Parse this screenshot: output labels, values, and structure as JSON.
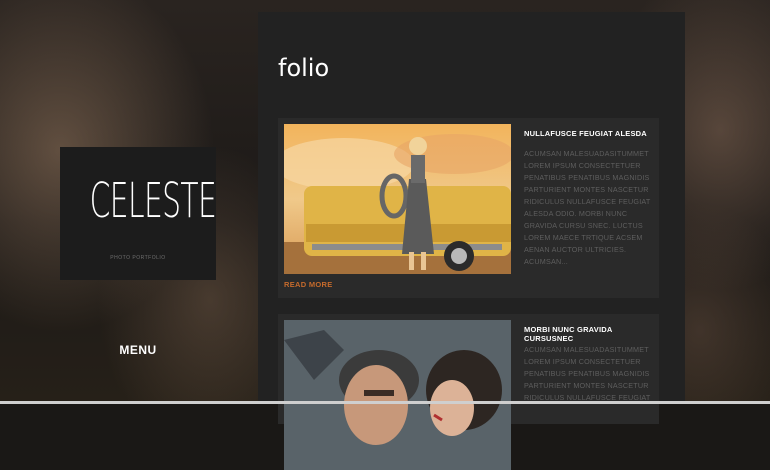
{
  "brand": {
    "logo_text": "CELESTE",
    "tagline": "PHOTO PORTFOLIO"
  },
  "nav": {
    "menu_label": "MENU"
  },
  "page": {
    "title": "folio"
  },
  "posts": [
    {
      "title": "NULLAFUSCE FEUGIAT ALESDA",
      "excerpt": "ACUMSAN MALESUADASITUMMET LOREM IPSUM CONSECTETUER PENATIBUS PENATIBUS MAGNIDIS PARTURIENT MONTES NASCETUR RIDICULUS NULLAFUSCE FEUGIAT ALESDA ODIO. MORBI NUNC GRAVIDA CURSU SNEC. LUCTUS LOREM MAECE TRTIQUE ACSEM AENAN AUCTOR ULTRICIES. ACUMSAN...",
      "read_more": "READ MORE"
    },
    {
      "title": "MORBI NUNC GRAVIDA CURSUSNEC",
      "excerpt": "ACUMSAN MALESUADASITUMMET LOREM IPSUM CONSECTETUER PENATIBUS PENATIBUS MAGNIDIS PARTURIENT MONTES NASCETUR RIDICULUS NULLAFUSCE FEUGIAT"
    }
  ],
  "colors": {
    "accent": "#c56a2c",
    "panel": "#222222",
    "card": "#2a2a2a",
    "muted_text": "#5e5e5e"
  }
}
